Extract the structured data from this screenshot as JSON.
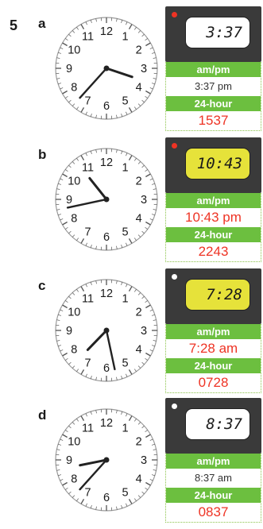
{
  "question_number": "5",
  "labels": {
    "ampm": "am/pm",
    "hour24": "24-hour"
  },
  "colors": {
    "green_label": "#6cbf3f",
    "red": "#ee3324",
    "yellow_screen": "#e6e23a"
  },
  "clock_numbers": [
    "12",
    "1",
    "2",
    "3",
    "4",
    "5",
    "6",
    "7",
    "8",
    "9",
    "10",
    "11"
  ],
  "items": [
    {
      "letter": "a",
      "digital": "3:37",
      "led": "red",
      "screen": "white",
      "ampm": "3:37 pm",
      "ampm_color": "dark",
      "h24": "1537",
      "time": {
        "hour": 3,
        "minute": 37
      }
    },
    {
      "letter": "b",
      "digital": "10:43",
      "led": "red",
      "screen": "yellow",
      "ampm": "10:43 pm",
      "ampm_color": "red",
      "h24": "2243",
      "time": {
        "hour": 10,
        "minute": 43
      }
    },
    {
      "letter": "c",
      "digital": "7:28",
      "led": "white",
      "screen": "yellow",
      "ampm": "7:28 am",
      "ampm_color": "red",
      "h24": "0728",
      "time": {
        "hour": 7,
        "minute": 28
      }
    },
    {
      "letter": "d",
      "digital": "8:37",
      "led": "white",
      "screen": "white",
      "ampm": "8:37 am",
      "ampm_color": "dark",
      "h24": "0837",
      "time": {
        "hour": 8,
        "minute": 37
      }
    }
  ]
}
